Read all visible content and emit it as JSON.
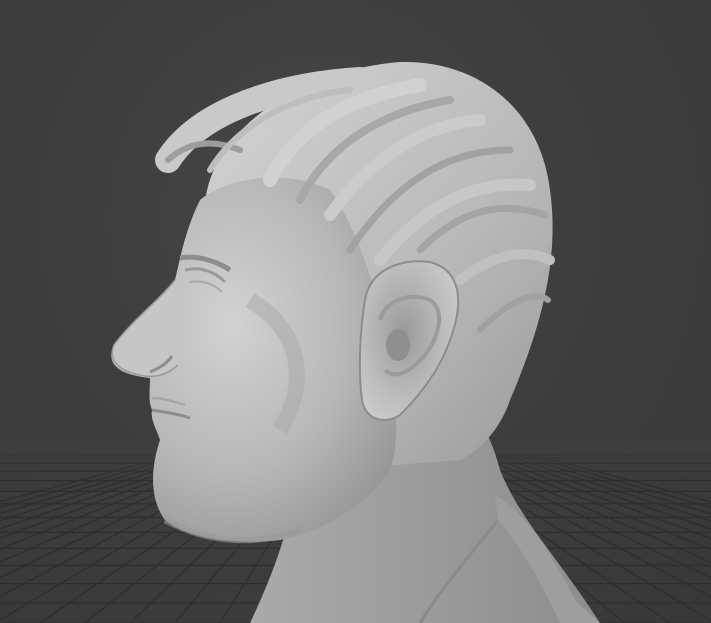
{
  "viewport": {
    "background_color": "#3e3e3e",
    "grid_color": "#2e2e2e",
    "horizon_color": "#444444"
  },
  "model": {
    "object": "sculpted-head-bust",
    "material_color": "#b9b9b9",
    "shadow_color": "#8a8a8a",
    "highlight_color": "#d2d2d2"
  }
}
